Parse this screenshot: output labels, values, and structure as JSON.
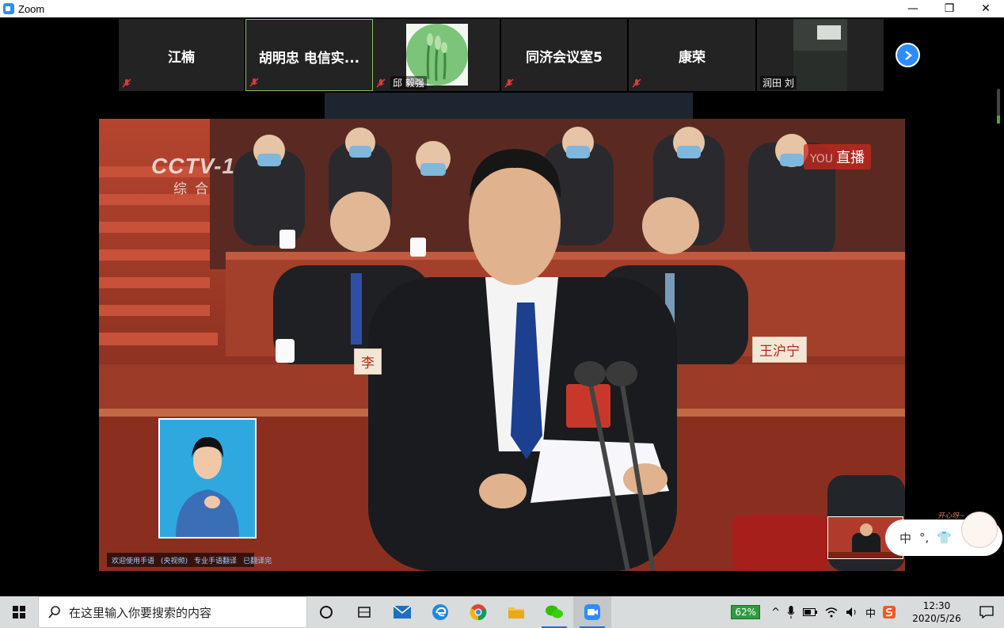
{
  "window": {
    "title": "Zoom",
    "minimize": "—",
    "restore": "❐",
    "close": "✕"
  },
  "participants": [
    {
      "name": "江楠",
      "muted": true
    },
    {
      "name": "胡明忠   电信实...",
      "muted": true,
      "active": true
    },
    {
      "name": "邱 毅强",
      "muted": true,
      "has_image": true
    },
    {
      "name": "同济会议室5",
      "muted": true
    },
    {
      "name": "康荣",
      "muted": true
    },
    {
      "name": "润田 刘",
      "muted": false,
      "has_video": true
    }
  ],
  "video": {
    "channel_logo": "CCTV-1",
    "channel_sub": "综合",
    "live_prefix": "YOU",
    "live_label": "直播",
    "nameplate_1": "李",
    "nameplate_2": "王沪宁",
    "ticker_items": [
      "欢迎使用手语",
      "(央视频)",
      "专业手语翻译",
      "已翻译完"
    ]
  },
  "ime": {
    "mode": "中",
    "punct": "°,",
    "skin": "👕",
    "deco_text": "开心呀~"
  },
  "taskbar": {
    "search_placeholder": "在这里输入你要搜索的内容",
    "battery_percent": "62%",
    "ime_indicator": "中",
    "time": "12:30",
    "date": "2020/5/26"
  },
  "colors": {
    "zoom_blue": "#2d8cff",
    "active_border": "#8bc34a",
    "muted_red": "#e53935"
  }
}
